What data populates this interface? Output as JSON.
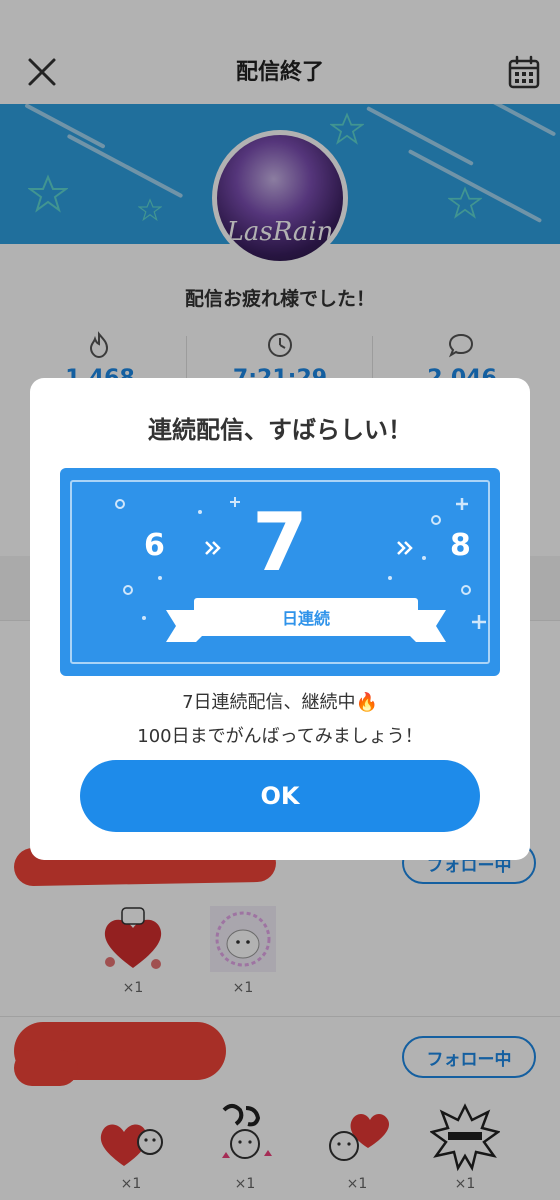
{
  "header": {
    "title": "配信終了"
  },
  "banner": {
    "avatar_text": "LasRain"
  },
  "thanks_message": "配信お疲れ様でした！",
  "stats": [
    {
      "icon": "flame-icon",
      "value": "1,468"
    },
    {
      "icon": "clock-icon",
      "value": "7:21:29"
    },
    {
      "icon": "comment-icon",
      "value": "2,046"
    }
  ],
  "fans": [
    {
      "follow_label": "フォロー中",
      "gifts": [
        {
          "icon": "heart-sticker-icon",
          "count": "×1"
        },
        {
          "icon": "character-sticker-icon",
          "count": "×1"
        }
      ]
    },
    {
      "follow_label": "フォロー中",
      "gifts": [
        {
          "icon": "daisuki-sticker-icon",
          "count": "×1"
        },
        {
          "icon": "sugoi-sticker-icon",
          "count": "×1"
        },
        {
          "icon": "love-sticker-icon",
          "count": "×1"
        },
        {
          "icon": "ittaikan-sticker-icon",
          "count": "×1"
        }
      ]
    }
  ],
  "modal": {
    "title": "連続配信、すばらしい！",
    "prev_day": "6",
    "current_day": "7",
    "next_day": "8",
    "ribbon_label": "日連続",
    "line1": "7日連続配信、継続中🔥",
    "line2": "100日までがんばってみましょう！",
    "ok_label": "OK"
  },
  "colors": {
    "accent": "#1e88e5",
    "banner": "#2f9fe0",
    "card": "#2f93ea",
    "redaction": "#f04438"
  }
}
